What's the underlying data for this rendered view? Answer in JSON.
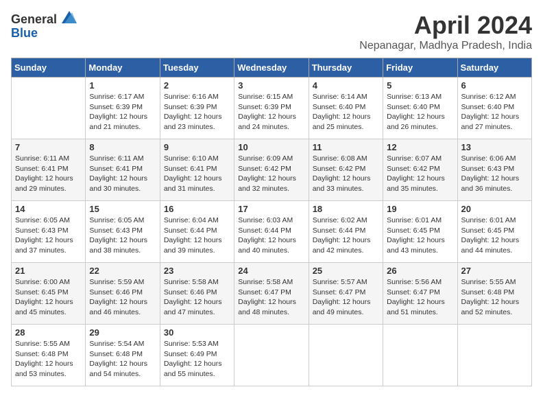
{
  "header": {
    "logo_general": "General",
    "logo_blue": "Blue",
    "month_title": "April 2024",
    "location": "Nepanagar, Madhya Pradesh, India"
  },
  "days_of_week": [
    "Sunday",
    "Monday",
    "Tuesday",
    "Wednesday",
    "Thursday",
    "Friday",
    "Saturday"
  ],
  "weeks": [
    [
      {
        "day": "",
        "info": ""
      },
      {
        "day": "1",
        "info": "Sunrise: 6:17 AM\nSunset: 6:39 PM\nDaylight: 12 hours\nand 21 minutes."
      },
      {
        "day": "2",
        "info": "Sunrise: 6:16 AM\nSunset: 6:39 PM\nDaylight: 12 hours\nand 23 minutes."
      },
      {
        "day": "3",
        "info": "Sunrise: 6:15 AM\nSunset: 6:39 PM\nDaylight: 12 hours\nand 24 minutes."
      },
      {
        "day": "4",
        "info": "Sunrise: 6:14 AM\nSunset: 6:40 PM\nDaylight: 12 hours\nand 25 minutes."
      },
      {
        "day": "5",
        "info": "Sunrise: 6:13 AM\nSunset: 6:40 PM\nDaylight: 12 hours\nand 26 minutes."
      },
      {
        "day": "6",
        "info": "Sunrise: 6:12 AM\nSunset: 6:40 PM\nDaylight: 12 hours\nand 27 minutes."
      }
    ],
    [
      {
        "day": "7",
        "info": "Sunrise: 6:11 AM\nSunset: 6:41 PM\nDaylight: 12 hours\nand 29 minutes."
      },
      {
        "day": "8",
        "info": "Sunrise: 6:11 AM\nSunset: 6:41 PM\nDaylight: 12 hours\nand 30 minutes."
      },
      {
        "day": "9",
        "info": "Sunrise: 6:10 AM\nSunset: 6:41 PM\nDaylight: 12 hours\nand 31 minutes."
      },
      {
        "day": "10",
        "info": "Sunrise: 6:09 AM\nSunset: 6:42 PM\nDaylight: 12 hours\nand 32 minutes."
      },
      {
        "day": "11",
        "info": "Sunrise: 6:08 AM\nSunset: 6:42 PM\nDaylight: 12 hours\nand 33 minutes."
      },
      {
        "day": "12",
        "info": "Sunrise: 6:07 AM\nSunset: 6:42 PM\nDaylight: 12 hours\nand 35 minutes."
      },
      {
        "day": "13",
        "info": "Sunrise: 6:06 AM\nSunset: 6:43 PM\nDaylight: 12 hours\nand 36 minutes."
      }
    ],
    [
      {
        "day": "14",
        "info": "Sunrise: 6:05 AM\nSunset: 6:43 PM\nDaylight: 12 hours\nand 37 minutes."
      },
      {
        "day": "15",
        "info": "Sunrise: 6:05 AM\nSunset: 6:43 PM\nDaylight: 12 hours\nand 38 minutes."
      },
      {
        "day": "16",
        "info": "Sunrise: 6:04 AM\nSunset: 6:44 PM\nDaylight: 12 hours\nand 39 minutes."
      },
      {
        "day": "17",
        "info": "Sunrise: 6:03 AM\nSunset: 6:44 PM\nDaylight: 12 hours\nand 40 minutes."
      },
      {
        "day": "18",
        "info": "Sunrise: 6:02 AM\nSunset: 6:44 PM\nDaylight: 12 hours\nand 42 minutes."
      },
      {
        "day": "19",
        "info": "Sunrise: 6:01 AM\nSunset: 6:45 PM\nDaylight: 12 hours\nand 43 minutes."
      },
      {
        "day": "20",
        "info": "Sunrise: 6:01 AM\nSunset: 6:45 PM\nDaylight: 12 hours\nand 44 minutes."
      }
    ],
    [
      {
        "day": "21",
        "info": "Sunrise: 6:00 AM\nSunset: 6:45 PM\nDaylight: 12 hours\nand 45 minutes."
      },
      {
        "day": "22",
        "info": "Sunrise: 5:59 AM\nSunset: 6:46 PM\nDaylight: 12 hours\nand 46 minutes."
      },
      {
        "day": "23",
        "info": "Sunrise: 5:58 AM\nSunset: 6:46 PM\nDaylight: 12 hours\nand 47 minutes."
      },
      {
        "day": "24",
        "info": "Sunrise: 5:58 AM\nSunset: 6:47 PM\nDaylight: 12 hours\nand 48 minutes."
      },
      {
        "day": "25",
        "info": "Sunrise: 5:57 AM\nSunset: 6:47 PM\nDaylight: 12 hours\nand 49 minutes."
      },
      {
        "day": "26",
        "info": "Sunrise: 5:56 AM\nSunset: 6:47 PM\nDaylight: 12 hours\nand 51 minutes."
      },
      {
        "day": "27",
        "info": "Sunrise: 5:55 AM\nSunset: 6:48 PM\nDaylight: 12 hours\nand 52 minutes."
      }
    ],
    [
      {
        "day": "28",
        "info": "Sunrise: 5:55 AM\nSunset: 6:48 PM\nDaylight: 12 hours\nand 53 minutes."
      },
      {
        "day": "29",
        "info": "Sunrise: 5:54 AM\nSunset: 6:48 PM\nDaylight: 12 hours\nand 54 minutes."
      },
      {
        "day": "30",
        "info": "Sunrise: 5:53 AM\nSunset: 6:49 PM\nDaylight: 12 hours\nand 55 minutes."
      },
      {
        "day": "",
        "info": ""
      },
      {
        "day": "",
        "info": ""
      },
      {
        "day": "",
        "info": ""
      },
      {
        "day": "",
        "info": ""
      }
    ]
  ]
}
